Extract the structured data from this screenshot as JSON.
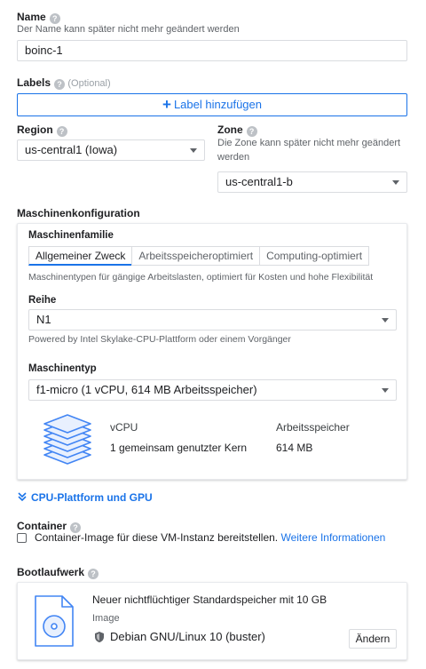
{
  "name": {
    "label": "Name",
    "hint": "Der Name kann später nicht mehr geändert werden",
    "value": "boinc-1"
  },
  "labels": {
    "label": "Labels",
    "optional": "(Optional)",
    "add_button": "Label hinzufügen"
  },
  "region": {
    "label": "Region",
    "value": "us-central1 (Iowa)"
  },
  "zone": {
    "label": "Zone",
    "hint": "Die Zone kann später nicht mehr geändert werden",
    "value": "us-central1-b"
  },
  "machine_config": {
    "label": "Maschinenkonfiguration",
    "family_label": "Maschinenfamilie",
    "tabs": [
      {
        "label": "Allgemeiner Zweck",
        "active": true
      },
      {
        "label": "Arbeitsspeicheroptimiert",
        "active": false
      },
      {
        "label": "Computing-optimiert",
        "active": false
      }
    ],
    "family_desc": "Maschinentypen für gängige Arbeitslasten, optimiert für Kosten und hohe Flexibilität",
    "series_label": "Reihe",
    "series_value": "N1",
    "series_hint": "Powered by Intel Skylake-CPU-Plattform oder einem Vorgänger",
    "type_label": "Maschinentyp",
    "type_value": "f1-micro (1 vCPU, 614 MB Arbeitsspeicher)",
    "summary": {
      "vcpu_header": "vCPU",
      "vcpu_value": "1 gemeinsam genutzter Kern",
      "mem_header": "Arbeitsspeicher",
      "mem_value": "614 MB"
    }
  },
  "cpu_platform": {
    "label": "CPU-Plattform und GPU"
  },
  "container": {
    "label": "Container",
    "checkbox_text": "Container-Image für diese VM-Instanz bereitstellen.",
    "link": "Weitere Informationen",
    "checked": false
  },
  "boot_disk": {
    "label": "Bootlaufwerk",
    "desc": "Neuer nichtflüchtiger Standardspeicher mit 10 GB",
    "image_label": "Image",
    "image_value": "Debian GNU/Linux 10 (buster)",
    "change_button": "Ändern"
  },
  "colors": {
    "accent": "#1a73e8",
    "icon_blue": "#4285f4"
  }
}
